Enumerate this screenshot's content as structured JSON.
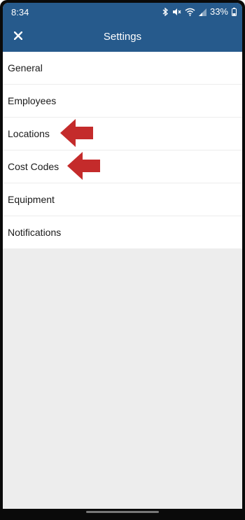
{
  "status_bar": {
    "time": "8:34",
    "battery_percent": "33%"
  },
  "header": {
    "title": "Settings",
    "close_icon": "close-icon",
    "background_color": "#265a8c"
  },
  "menu": {
    "items": [
      {
        "label": "General"
      },
      {
        "label": "Employees"
      },
      {
        "label": "Locations",
        "highlighted": true
      },
      {
        "label": "Cost Codes",
        "highlighted": true
      },
      {
        "label": "Equipment"
      },
      {
        "label": "Notifications"
      }
    ]
  },
  "annotation": {
    "arrow_color": "#c42b2b"
  }
}
